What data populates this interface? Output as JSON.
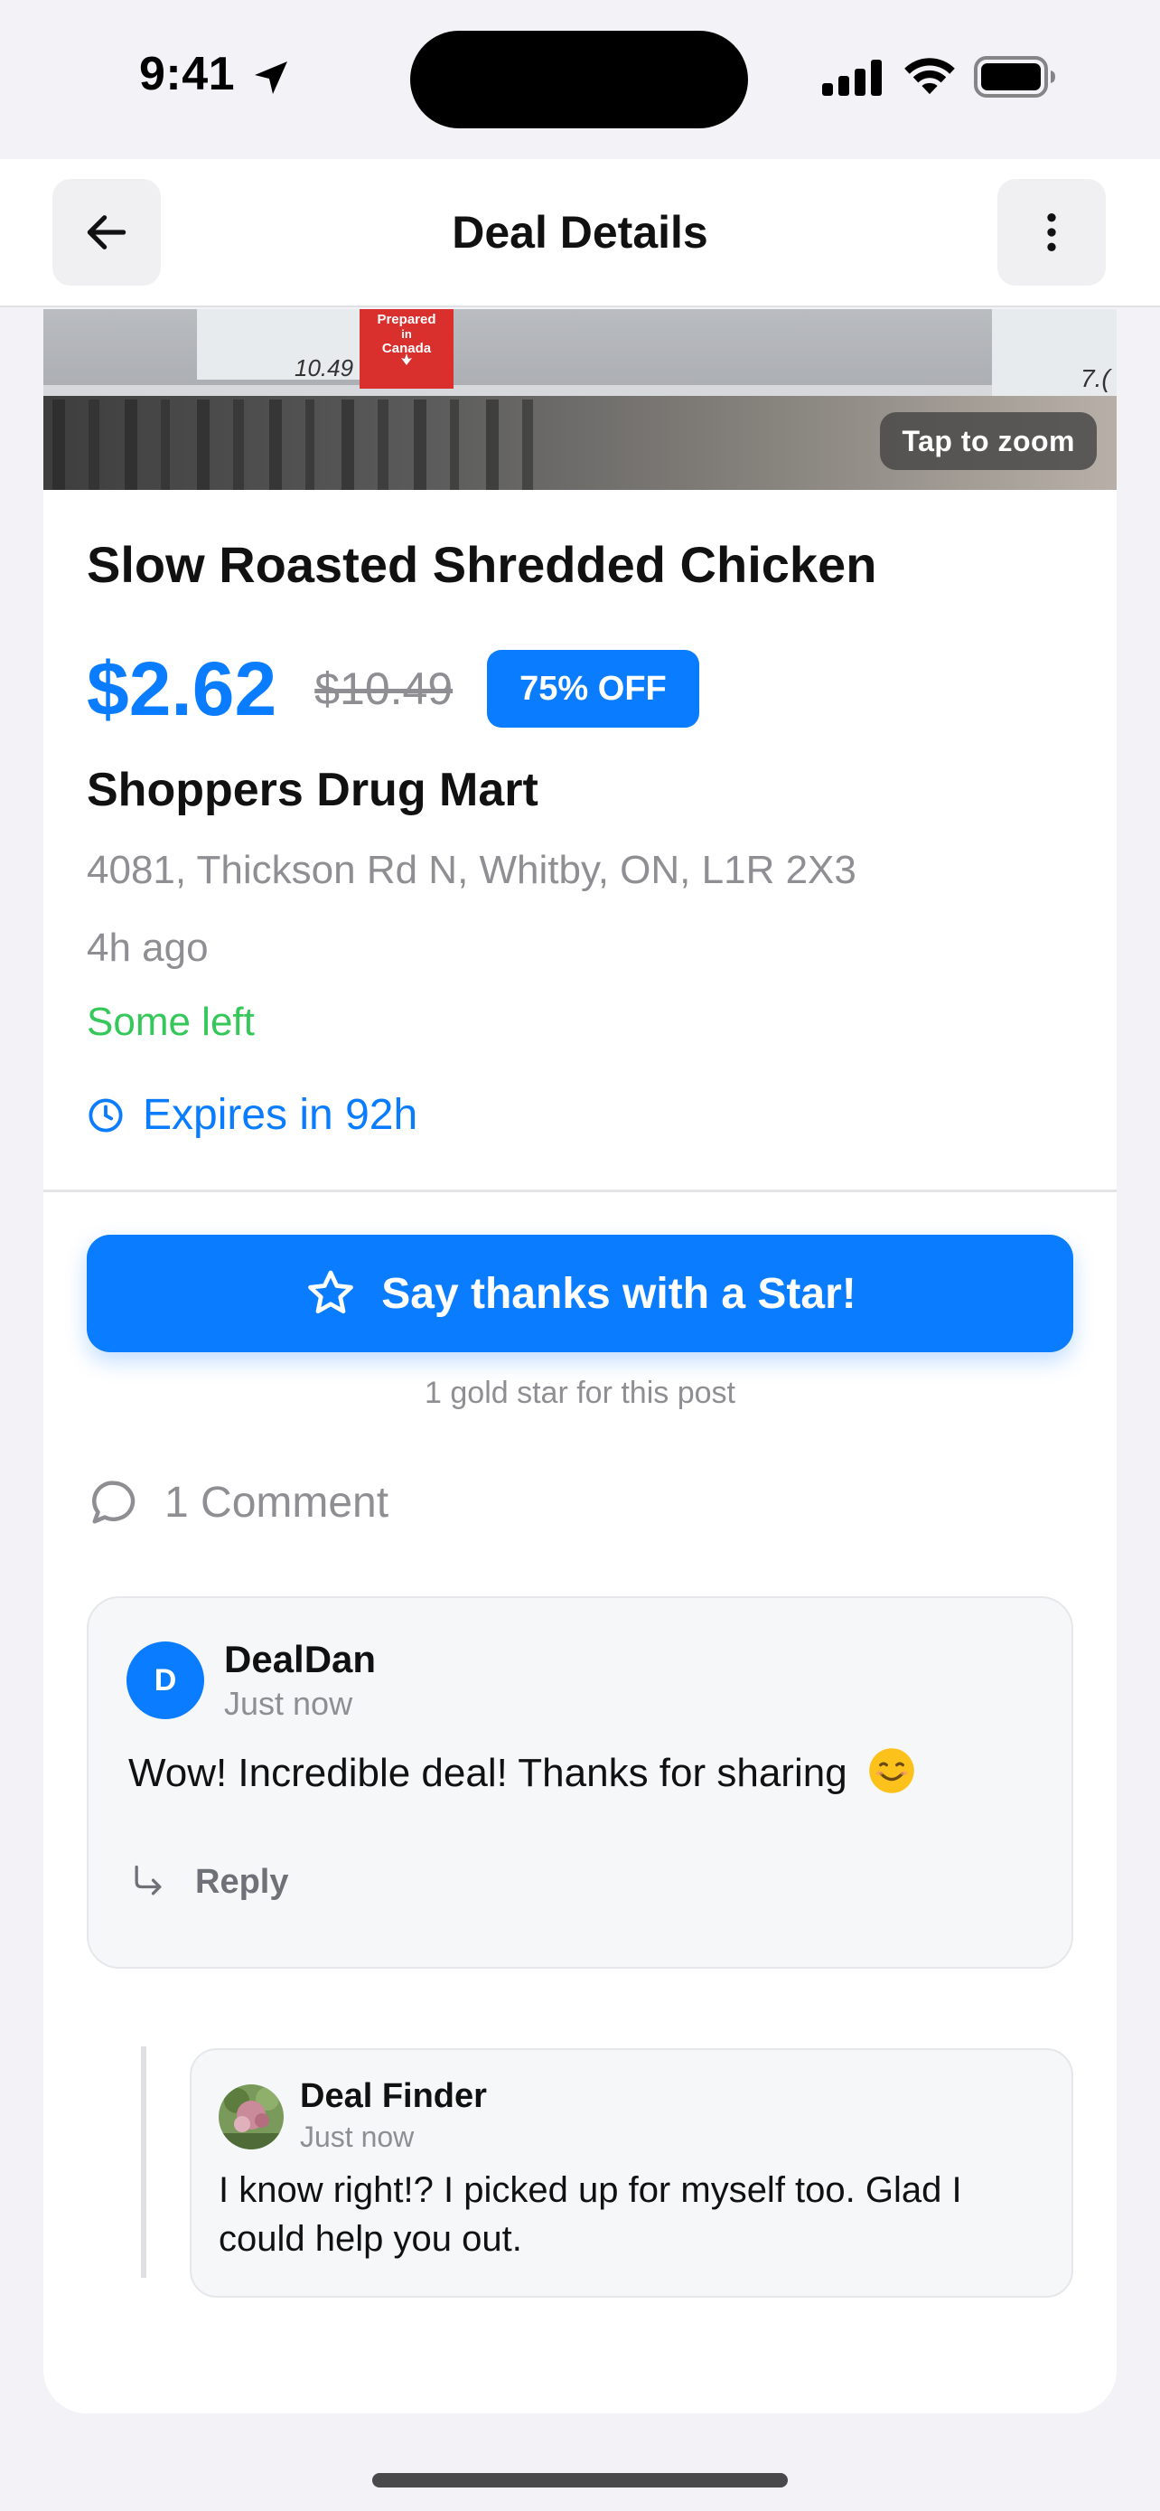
{
  "status_bar": {
    "time": "9:41"
  },
  "nav": {
    "title": "Deal Details"
  },
  "photo": {
    "zoom_label": "Tap to zoom",
    "tag_price_left": "10.49",
    "tag_canada_line1": "Prepared",
    "tag_canada_line2": "in",
    "tag_canada_line3": "Canada",
    "tag_price_right": "7.("
  },
  "deal": {
    "title": "Slow Roasted Shredded Chicken",
    "price": "$2.62",
    "original_price": "$10.49",
    "discount": "75% OFF",
    "store": "Shoppers Drug Mart",
    "address": "4081, Thickson Rd N, Whitby, ON, L1R 2X3",
    "posted": "4h ago",
    "stock": "Some left",
    "expires": "Expires in 92h"
  },
  "star": {
    "button_label": "Say thanks with a Star!",
    "note": "1 gold star for this post"
  },
  "comments": {
    "heading": "1 Comment",
    "items": [
      {
        "initial": "D",
        "author": "DealDan",
        "time": "Just now",
        "text": "Wow! Incredible deal! Thanks for sharing",
        "reply_label": "Reply"
      }
    ],
    "replies": [
      {
        "author": "Deal Finder",
        "time": "Just now",
        "text": "I know right!? I picked up for myself too. Glad I could help you out."
      }
    ]
  },
  "colors": {
    "accent": "#0a7cff",
    "stock_green": "#34c759",
    "muted": "#8e8e93"
  }
}
